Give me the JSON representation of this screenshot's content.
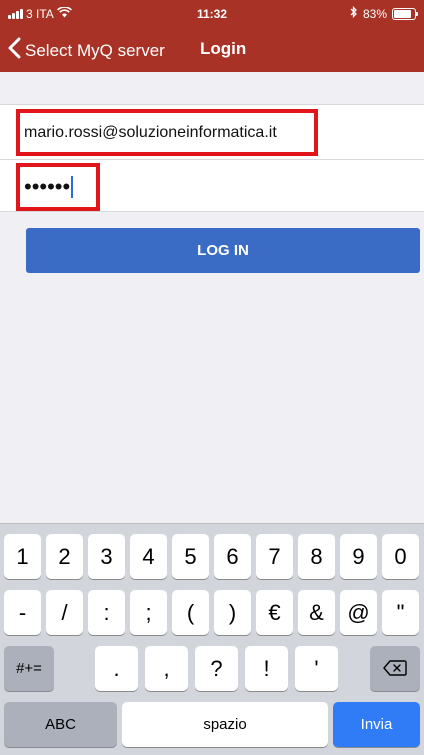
{
  "status_bar": {
    "carrier": "3 ITA",
    "time": "11:32",
    "battery_percent": "83%",
    "battery_level": 0.83,
    "icons": [
      "signal-icon",
      "wifi-icon",
      "bluetooth-icon",
      "battery-icon"
    ]
  },
  "nav": {
    "back_label": "Select MyQ server",
    "title": "Login"
  },
  "form": {
    "email_value": "mario.rossi@soluzioneinformatica.it",
    "password_mask": "••••••",
    "login_label": "LOG IN"
  },
  "colors": {
    "header": "#a93226",
    "highlight_border": "#e0161a",
    "login_button": "#3a6bc5",
    "return_key": "#2f7cf6"
  },
  "keyboard": {
    "row1": [
      "1",
      "2",
      "3",
      "4",
      "5",
      "6",
      "7",
      "8",
      "9",
      "0"
    ],
    "row2": [
      "-",
      "/",
      ":",
      ";",
      "(",
      ")",
      "€",
      "&",
      "@",
      "\""
    ],
    "row3_left": "#+=",
    "row3": [
      ".",
      ",",
      "?",
      "!",
      "'"
    ],
    "abc": "ABC",
    "space": "spazio",
    "return": "Invia"
  }
}
